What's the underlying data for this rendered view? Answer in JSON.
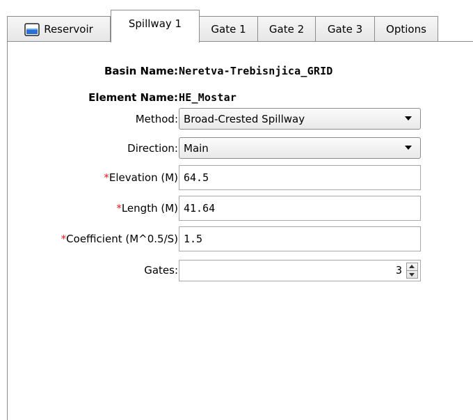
{
  "tabs": [
    {
      "label": "Reservoir",
      "icon": "reservoir-icon",
      "active": false
    },
    {
      "label": "Spillway 1",
      "active": true
    },
    {
      "label": "Gate 1",
      "active": false
    },
    {
      "label": "Gate 2",
      "active": false
    },
    {
      "label": "Gate 3",
      "active": false
    },
    {
      "label": "Options",
      "active": false
    }
  ],
  "form": {
    "basin_name_label": "Basin Name:",
    "basin_name_value": "Neretva-Trebisnjica_GRID",
    "element_name_label": "Element Name:",
    "element_name_value": "HE_Mostar",
    "method_label": "Method:",
    "method_value": "Broad-Crested Spillway",
    "direction_label": "Direction:",
    "direction_value": "Main",
    "required_marker": "*",
    "elevation_label": "Elevation (M)",
    "elevation_value": "64.5",
    "length_label": "Length (M)",
    "length_value": "41.64",
    "coefficient_label": "Coefficient (M^0.5/S)",
    "coefficient_value": "1.5",
    "gates_label": "Gates:",
    "gates_value": "3"
  },
  "colors": {
    "required_marker": "#e02020",
    "reservoir_icon_fill": "#2a6fd6"
  }
}
